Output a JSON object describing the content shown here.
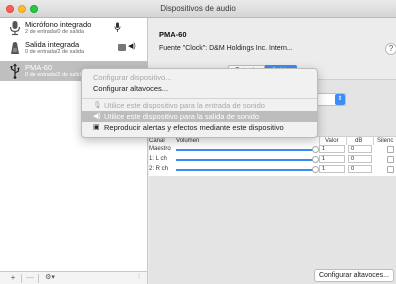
{
  "window": {
    "title": "Dispositivos de audio"
  },
  "sidebar": {
    "devices": [
      {
        "name": "Micrófono integrado",
        "sub": "2 de entrada/0 de salida",
        "icon": "microphone-icon"
      },
      {
        "name": "Salida integrada",
        "sub": "0 de entrada/2 de salida",
        "icon": "speaker-icon"
      },
      {
        "name": "PMA-60",
        "sub": "0 de entrada/2 de salida",
        "icon": "usb-icon"
      }
    ],
    "bottom": {
      "add": "+",
      "remove": "—",
      "gear": "⚙▾"
    }
  },
  "detail": {
    "device_title": "PMA-60",
    "clock_line": "Fuente \"Clock\":  D&M Holdings Inc. Intern...",
    "help": "?",
    "tabs": [
      "Entrada",
      "Salida"
    ],
    "selected_tab": "Salida",
    "format_text": "its, entero",
    "table": {
      "headers": {
        "channel": "Canal",
        "volume": "Volumen",
        "value": "Valor",
        "db": "dB",
        "mute": "Silenc"
      },
      "rows": [
        {
          "channel": "Maestro",
          "value": "1",
          "db": "0"
        },
        {
          "channel": "1: L ch",
          "value": "1",
          "db": "0"
        },
        {
          "channel": "2: R ch",
          "value": "1",
          "db": "0"
        }
      ]
    },
    "configure_speakers_button": "Configurar altavoces..."
  },
  "context_menu": {
    "items": [
      {
        "label": "Configurar dispositivo...",
        "enabled": false
      },
      {
        "label": "Configurar altavoces...",
        "enabled": true
      },
      {
        "label": "Utilice este dispositivo para la entrada de sonido",
        "enabled": false,
        "icon": "microphone-icon"
      },
      {
        "label": "Utilice este dispositivo para la salida de sonido",
        "enabled": true,
        "highlighted": true,
        "icon": "speaker-icon"
      },
      {
        "label": "Reproducir alertas y efectos mediante este dispositivo",
        "enabled": true,
        "icon": "alert-speaker-icon"
      }
    ]
  },
  "colors": {
    "accent": "#3b8cf5",
    "selection": "#bfbfbf"
  }
}
